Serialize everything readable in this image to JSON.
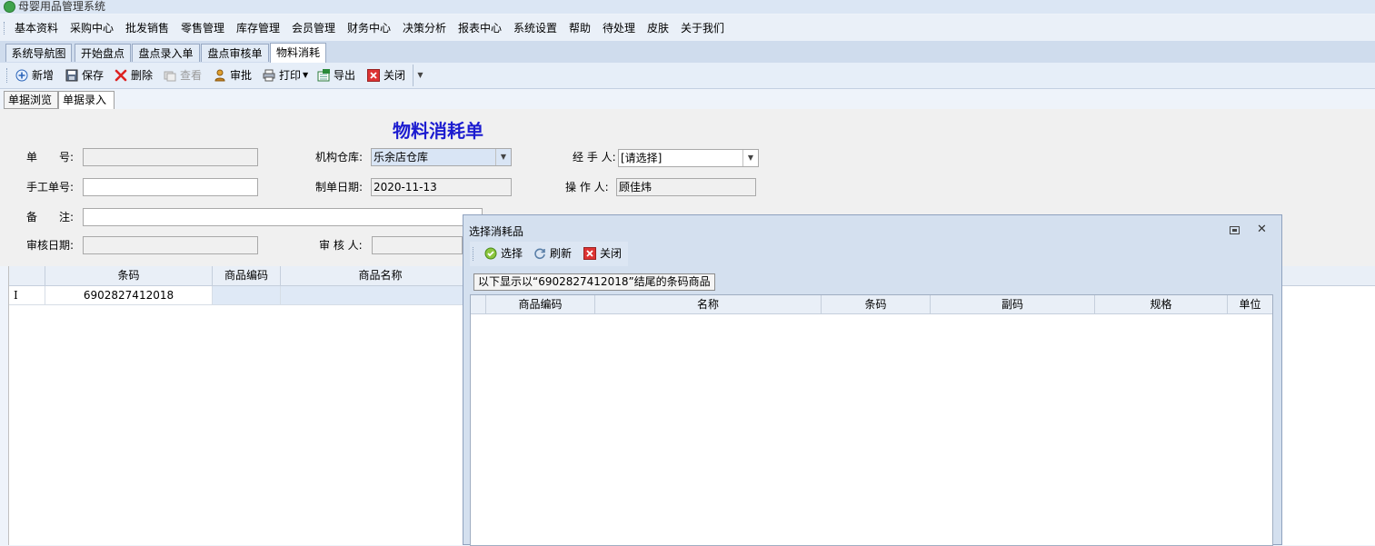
{
  "app": {
    "title": "母婴用品管理系统"
  },
  "menu": [
    "基本资料",
    "采购中心",
    "批发销售",
    "零售管理",
    "库存管理",
    "会员管理",
    "财务中心",
    "决策分析",
    "报表中心",
    "系统设置",
    "帮助",
    "待处理",
    "皮肤",
    "关于我们"
  ],
  "doc_tabs": [
    "系统导航图",
    "开始盘点",
    "盘点录入单",
    "盘点审核单",
    "物料消耗"
  ],
  "toolbar": {
    "new": "新增",
    "save": "保存",
    "delete": "删除",
    "view": "查看",
    "approve": "审批",
    "print": "打印",
    "export": "导出",
    "close": "关闭"
  },
  "sub_tabs": [
    "单据浏览",
    "单据录入"
  ],
  "form": {
    "title": "物料消耗单",
    "doc_no_label": "单　　号:",
    "warehouse_label": "机构仓库:",
    "warehouse_value": "乐余店仓库",
    "handler_label": "经 手 人:",
    "handler_value": "[请选择]",
    "manual_no_label": "手工单号:",
    "date_label": "制单日期:",
    "date_value": "2020-11-13",
    "operator_label": "操 作 人:",
    "operator_value": "顾佳炜",
    "remark_label": "备　　注:",
    "audit_date_label": "审核日期:",
    "auditor_label": "审 核 人:"
  },
  "grid": {
    "columns": [
      "条码",
      "商品编码",
      "商品名称"
    ],
    "rows": [
      {
        "indicator": "I",
        "barcode": "6902827412018",
        "code": "",
        "name": ""
      }
    ]
  },
  "dialog": {
    "title": "选择消耗品",
    "select": "选择",
    "refresh": "刷新",
    "close": "关闭",
    "message": "以下显示以“6902827412018”结尾的条码商品",
    "columns": [
      "商品编码",
      "名称",
      "条码",
      "副码",
      "规格",
      "单位"
    ]
  }
}
